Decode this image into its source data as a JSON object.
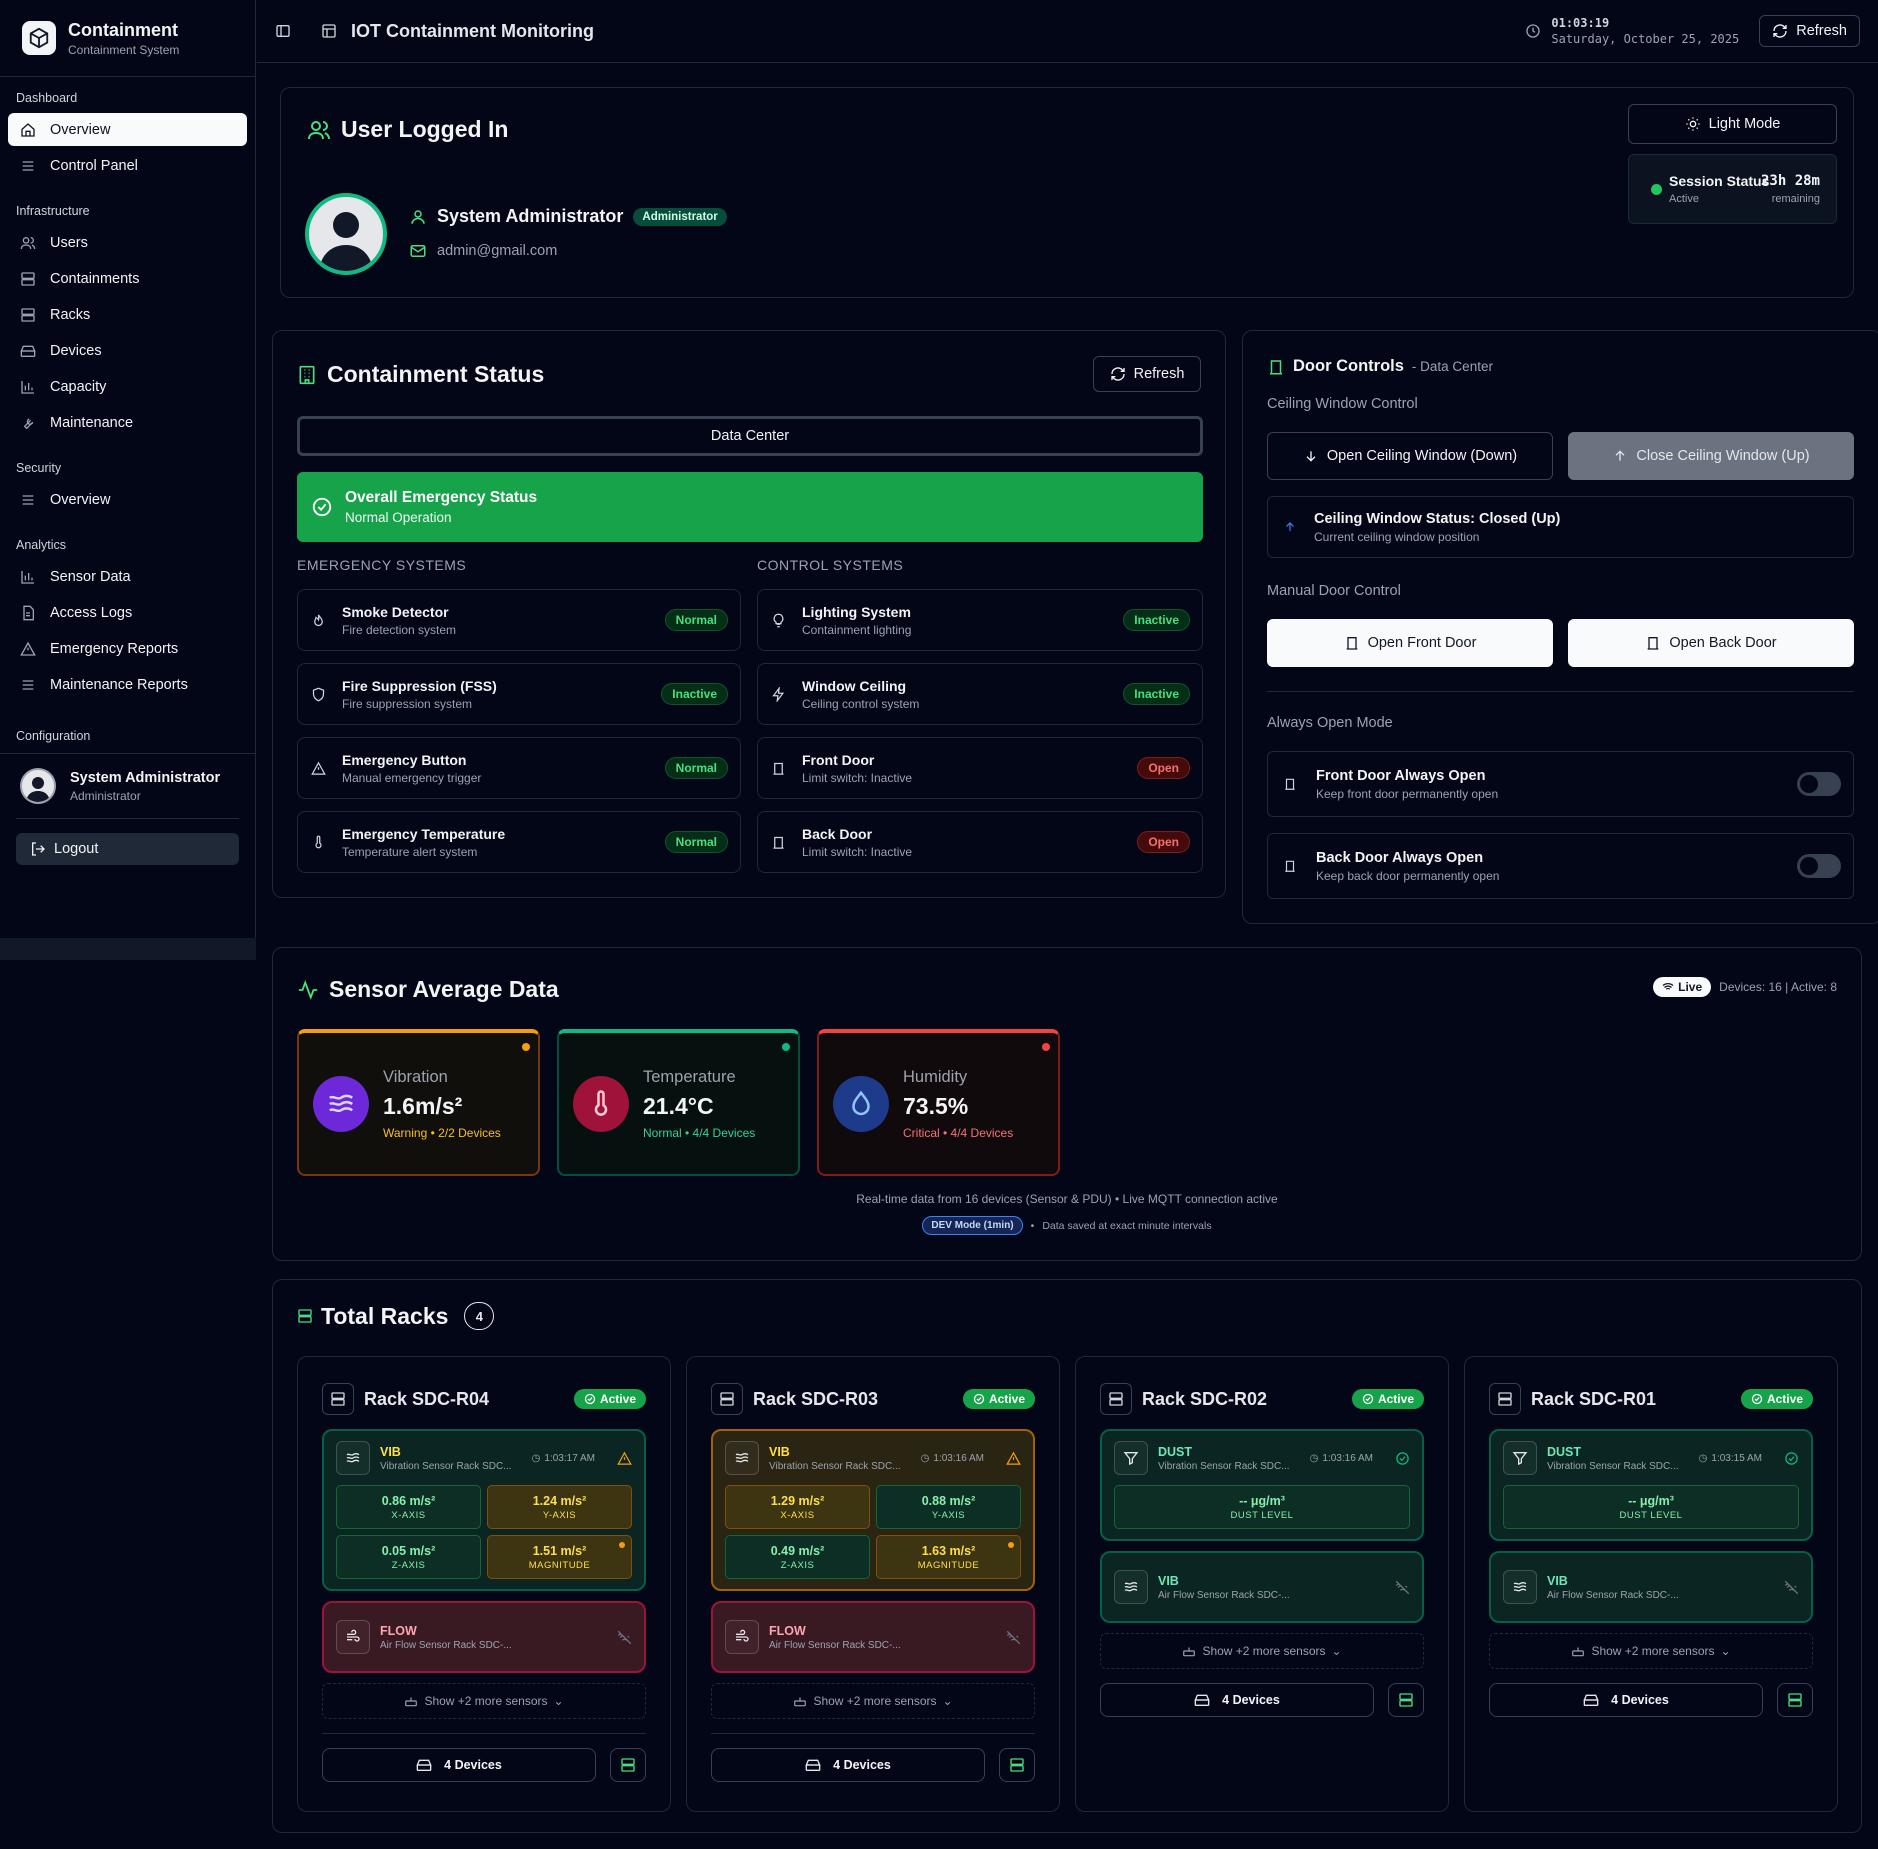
{
  "sidebar": {
    "app_title": "Containment",
    "app_subtitle": "Containment System",
    "groups": [
      {
        "label": "Dashboard",
        "items": [
          {
            "label": "Overview"
          },
          {
            "label": "Control Panel"
          }
        ]
      },
      {
        "label": "Infrastructure",
        "items": [
          {
            "label": "Users"
          },
          {
            "label": "Containments"
          },
          {
            "label": "Racks"
          },
          {
            "label": "Devices"
          },
          {
            "label": "Capacity"
          },
          {
            "label": "Maintenance"
          }
        ]
      },
      {
        "label": "Security",
        "items": [
          {
            "label": "Overview"
          }
        ]
      },
      {
        "label": "Analytics",
        "items": [
          {
            "label": "Sensor Data"
          },
          {
            "label": "Access Logs"
          },
          {
            "label": "Emergency Reports"
          },
          {
            "label": "Maintenance Reports"
          }
        ]
      },
      {
        "label": "Configuration",
        "items": []
      }
    ],
    "user_name": "System Administrator",
    "user_role": "Administrator",
    "logout_label": "Logout"
  },
  "topbar": {
    "title": "IOT Containment Monitoring",
    "time": "01:03:19",
    "date": "Saturday, October 25, 2025",
    "refresh_label": "Refresh"
  },
  "user_card": {
    "title": "User Logged In",
    "name": "System Administrator",
    "role_badge": "Administrator",
    "email": "admin@gmail.com",
    "light_mode_label": "Light Mode",
    "session_label": "Session Status",
    "session_state": "Active",
    "session_time": "23h 28m",
    "session_remaining": "remaining"
  },
  "containment": {
    "title": "Containment Status",
    "refresh_label": "Refresh",
    "selector": "Data Center",
    "overall_title": "Overall Emergency Status",
    "overall_state": "Normal Operation",
    "emergency_header": "EMERGENCY SYSTEMS",
    "control_header": "CONTROL SYSTEMS",
    "emergency": [
      {
        "name": "Smoke Detector",
        "desc": "Fire detection system",
        "status": "Normal",
        "icon": "flame-icon"
      },
      {
        "name": "Fire Suppression (FSS)",
        "desc": "Fire suppression system",
        "status": "Inactive",
        "icon": "shield-icon"
      },
      {
        "name": "Emergency Button",
        "desc": "Manual emergency trigger",
        "status": "Normal",
        "icon": "alert-triangle-icon"
      },
      {
        "name": "Emergency Temperature",
        "desc": "Temperature alert system",
        "status": "Normal",
        "icon": "thermometer-icon"
      }
    ],
    "control": [
      {
        "name": "Lighting System",
        "desc": "Containment lighting",
        "status": "Inactive",
        "icon": "lightbulb-icon"
      },
      {
        "name": "Window Ceiling",
        "desc": "Ceiling control system",
        "status": "Inactive",
        "icon": "zap-icon"
      },
      {
        "name": "Front Door",
        "desc": "Limit switch: Inactive",
        "status": "Open",
        "icon": "door-icon"
      },
      {
        "name": "Back Door",
        "desc": "Limit switch: Inactive",
        "status": "Open",
        "icon": "door-icon"
      }
    ]
  },
  "door_controls": {
    "title": "Door Controls",
    "subtitle": "- Data Center",
    "ceiling_label": "Ceiling Window Control",
    "open_ceiling": "Open Ceiling Window (Down)",
    "close_ceiling": "Close Ceiling Window (Up)",
    "ceiling_status": "Ceiling Window Status: Closed (Up)",
    "ceiling_status_desc": "Current ceiling window position",
    "manual_label": "Manual Door Control",
    "open_front": "Open Front Door",
    "open_back": "Open Back Door",
    "always_open_label": "Always Open Mode",
    "front_always": "Front Door Always Open",
    "front_always_desc": "Keep front door permanently open",
    "back_always": "Back Door Always Open",
    "back_always_desc": "Keep back door permanently open"
  },
  "sensor_avg": {
    "title": "Sensor Average Data",
    "live_label": "Live",
    "devices_info": "Devices: 16 | Active: 8",
    "cards": [
      {
        "label": "Vibration",
        "value": "1.6m/s²",
        "status": "Warning • 2/2 Devices",
        "color": "#f59e0b"
      },
      {
        "label": "Temperature",
        "value": "21.4°C",
        "status": "Normal • 4/4 Devices",
        "color": "#10b981"
      },
      {
        "label": "Humidity",
        "value": "73.5%",
        "status": "Critical • 4/4 Devices",
        "color": "#ef4444"
      }
    ],
    "footer": "Real-time data from 16 devices (Sensor & PDU) • Live MQTT connection active",
    "dev_mode": "DEV Mode (1min)",
    "saved_note": "Data saved at exact minute intervals"
  },
  "racks": {
    "title": "Total Racks",
    "count": "4",
    "items": [
      {
        "name": "Rack SDC-R04",
        "status": "Active",
        "vib_name": "VIB",
        "vib_desc": "Vibration Sensor Rack SDC...",
        "vib_time": "1:03:17 AM",
        "x": "0.86 m/s²",
        "y": "1.24 m/s²",
        "z": "0.05 m/s²",
        "mag": "1.51 m/s²",
        "flow_name": "FLOW",
        "flow_desc": "Air Flow Sensor Rack SDC-...",
        "more": "Show +2 more sensors",
        "devices": "4 Devices"
      },
      {
        "name": "Rack SDC-R03",
        "status": "Active",
        "vib_name": "VIB",
        "vib_desc": "Vibration Sensor Rack SDC...",
        "vib_time": "1:03:16 AM",
        "x": "1.29 m/s²",
        "y": "0.88 m/s²",
        "z": "0.49 m/s²",
        "mag": "1.63 m/s²",
        "flow_name": "FLOW",
        "flow_desc": "Air Flow Sensor Rack SDC-...",
        "more": "Show +2 more sensors",
        "devices": "4 Devices"
      },
      {
        "name": "Rack SDC-R02",
        "status": "Active",
        "dust_name": "DUST",
        "dust_desc": "Vibration Sensor Rack SDC...",
        "dust_time": "1:03:16 AM",
        "dust_value": "-- μg/m³",
        "dust_label": "DUST LEVEL",
        "vib_name": "VIB",
        "vib_desc": "Air Flow Sensor Rack SDC-...",
        "more": "Show +2 more sensors",
        "devices": "4 Devices"
      },
      {
        "name": "Rack SDC-R01",
        "status": "Active",
        "dust_name": "DUST",
        "dust_desc": "Vibration Sensor Rack SDC...",
        "dust_time": "1:03:15 AM",
        "dust_value": "-- μg/m³",
        "dust_label": "DUST LEVEL",
        "vib_name": "VIB",
        "vib_desc": "Air Flow Sensor Rack SDC-...",
        "more": "Show +2 more sensors",
        "devices": "4 Devices"
      }
    ],
    "axis_labels": {
      "x": "X-AXIS",
      "y": "Y-AXIS",
      "z": "Z-AXIS",
      "mag": "MAGNITUDE"
    }
  }
}
